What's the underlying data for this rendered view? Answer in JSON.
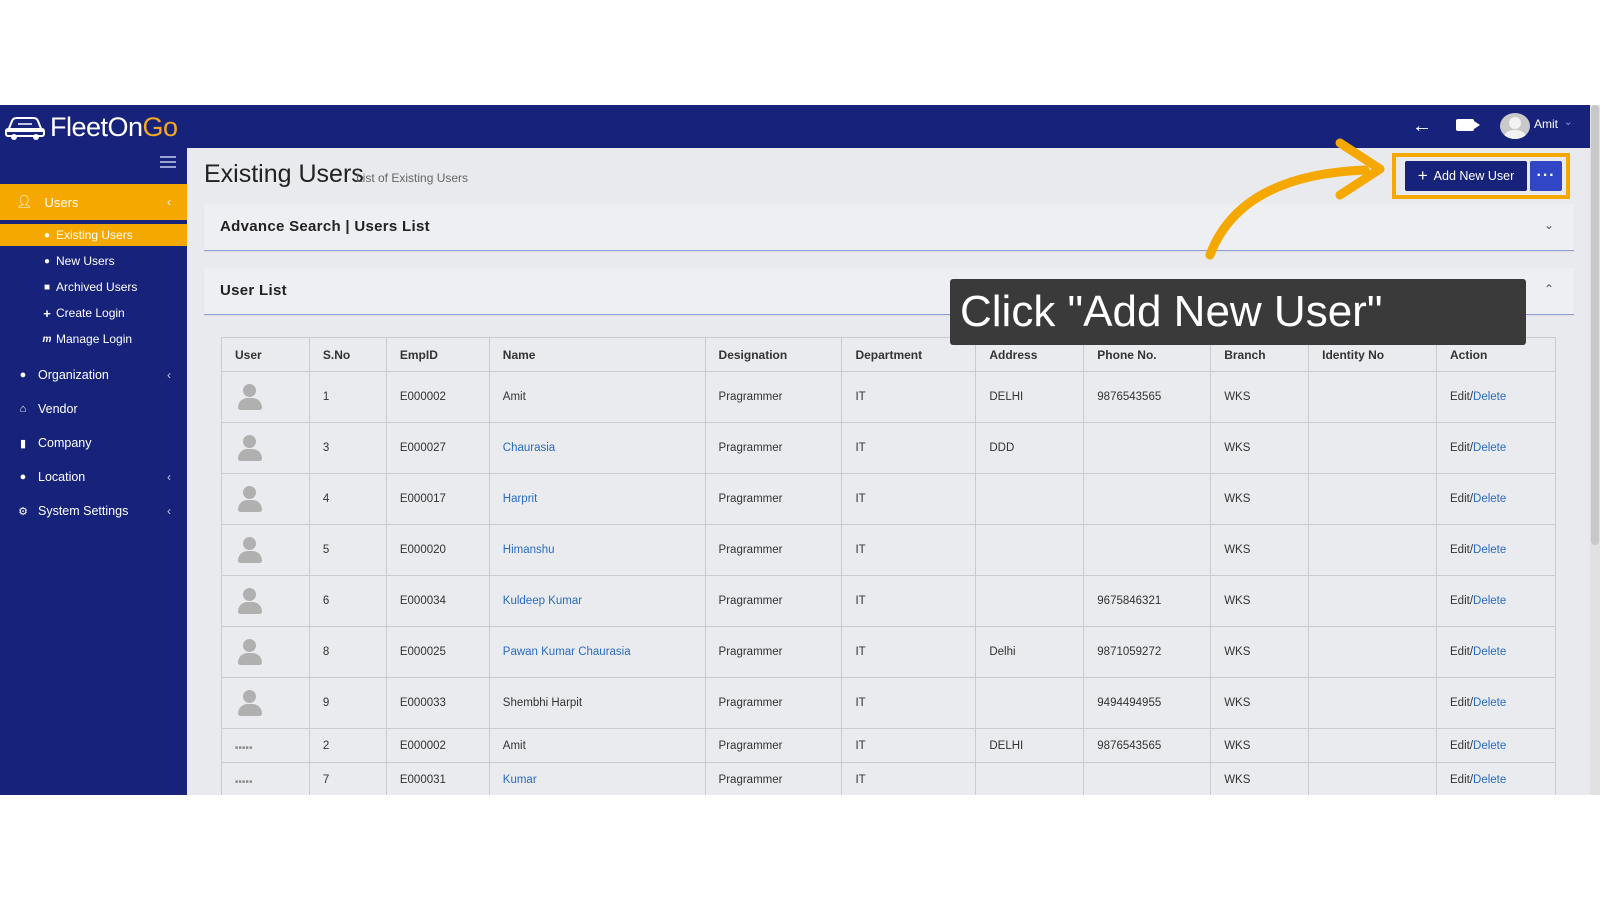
{
  "topbar": {
    "logo_fleet": "FleetOn",
    "logo_go": "Go",
    "user_name": "Amit"
  },
  "sidebar": {
    "users_label": "Users",
    "sub_items": [
      {
        "label": "Existing Users",
        "icon": "user-icon"
      },
      {
        "label": "New Users",
        "icon": "user-icon"
      },
      {
        "label": "Archived Users",
        "icon": "trash-icon"
      },
      {
        "label": "Create Login",
        "icon": "plus-icon"
      },
      {
        "label": "Manage Login",
        "icon": "m-icon"
      }
    ],
    "items": [
      {
        "label": "Organization",
        "icon": "user-icon"
      },
      {
        "label": "Vendor",
        "icon": "home-icon"
      },
      {
        "label": "Company",
        "icon": "building-icon"
      },
      {
        "label": "Location",
        "icon": "map-pin-icon"
      },
      {
        "label": "System Settings",
        "icon": "gear-icon"
      }
    ]
  },
  "main": {
    "title": "Existing Users",
    "subtitle": "List of Existing Users",
    "add_button": "Add New User",
    "more_button": "···",
    "search_panel_title": "Advance Search | Users List",
    "list_panel_title": "User List"
  },
  "callout": "Click \"Add New User\"",
  "table": {
    "headers": [
      "User",
      "S.No",
      "EmpID",
      "Name",
      "Designation",
      "Department",
      "Address",
      "Phone No.",
      "Branch",
      "Identity No",
      "Action"
    ],
    "rows": [
      {
        "sno": "1",
        "empid": "E000002",
        "name": "Amit",
        "name_link": false,
        "designation": "Pragrammer",
        "department": "IT",
        "address": "DELHI",
        "phone": "9876543565",
        "branch": "WKS",
        "identity": ""
      },
      {
        "sno": "3",
        "empid": "E000027",
        "name": "Chaurasia",
        "name_link": true,
        "designation": "Pragrammer",
        "department": "IT",
        "address": "DDD",
        "phone": "",
        "branch": "WKS",
        "identity": ""
      },
      {
        "sno": "4",
        "empid": "E000017",
        "name": "Harprit",
        "name_link": true,
        "designation": "Pragrammer",
        "department": "IT",
        "address": "",
        "phone": "",
        "branch": "WKS",
        "identity": ""
      },
      {
        "sno": "5",
        "empid": "E000020",
        "name": "Himanshu",
        "name_link": true,
        "designation": "Pragrammer",
        "department": "IT",
        "address": "",
        "phone": "",
        "branch": "WKS",
        "identity": ""
      },
      {
        "sno": "6",
        "empid": "E000034",
        "name": "Kuldeep Kumar",
        "name_link": true,
        "designation": "Pragrammer",
        "department": "IT",
        "address": "",
        "phone": "9675846321",
        "branch": "WKS",
        "identity": ""
      },
      {
        "sno": "8",
        "empid": "E000025",
        "name": "Pawan Kumar Chaurasia",
        "name_link": true,
        "designation": "Pragrammer",
        "department": "IT",
        "address": "Delhi",
        "phone": "9871059272",
        "branch": "WKS",
        "identity": ""
      },
      {
        "sno": "9",
        "empid": "E000033",
        "name": "Shembhi Harpit",
        "name_link": false,
        "designation": "Pragrammer",
        "department": "IT",
        "address": "",
        "phone": "9494494955",
        "branch": "WKS",
        "identity": ""
      },
      {
        "sno": "2",
        "empid": "E000002",
        "name": "Amit",
        "name_link": false,
        "designation": "Pragrammer",
        "department": "IT",
        "address": "DELHI",
        "phone": "9876543565",
        "branch": "WKS",
        "identity": ""
      },
      {
        "sno": "7",
        "empid": "E000031",
        "name": "Kumar",
        "name_link": true,
        "designation": "Pragrammer",
        "department": "IT",
        "address": "",
        "phone": "",
        "branch": "WKS",
        "identity": ""
      }
    ],
    "edit_label": "Edit",
    "slash": "/",
    "delete_label": "Delete"
  },
  "colors": {
    "navy": "#17237a",
    "accent": "#f5a800",
    "link": "#2a6cbf"
  }
}
